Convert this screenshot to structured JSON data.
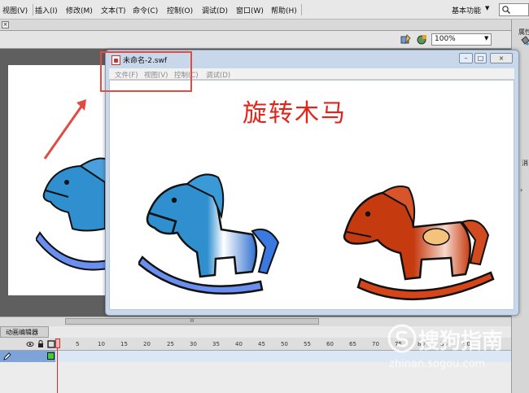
{
  "menubar": {
    "items": [
      "视图(V)",
      "插入(I)",
      "修改(M)",
      "文本(T)",
      "命令(C)",
      "控制(O)",
      "调试(D)",
      "窗口(W)",
      "帮助(H)"
    ],
    "workspace": "基本功能"
  },
  "editbar": {
    "zoom": "100%"
  },
  "right_panel": {
    "properties": "属性",
    "side_label": "消"
  },
  "hscroll_grip": "III",
  "timeline": {
    "tab": "动画编辑器",
    "ruler": [
      "1",
      "5",
      "10",
      "15",
      "20",
      "25",
      "30",
      "35",
      "40",
      "45",
      "50",
      "55",
      "60",
      "65",
      "70",
      "75",
      "80",
      "85",
      "90"
    ]
  },
  "player": {
    "title": "未命名-2.swf",
    "menus": [
      "文件(F)",
      "视图(V)",
      "控制(C)",
      "调试(D)"
    ],
    "content_title": "旋转木马"
  },
  "watermark": {
    "text": "搜狗指南",
    "sub": "zhinan.sogou.com"
  },
  "colors": {
    "title_red": "#e1251b",
    "annotation_red": "#e24b42",
    "horse_blue": "#2f8fcf",
    "horse_red": "#c63a10"
  }
}
